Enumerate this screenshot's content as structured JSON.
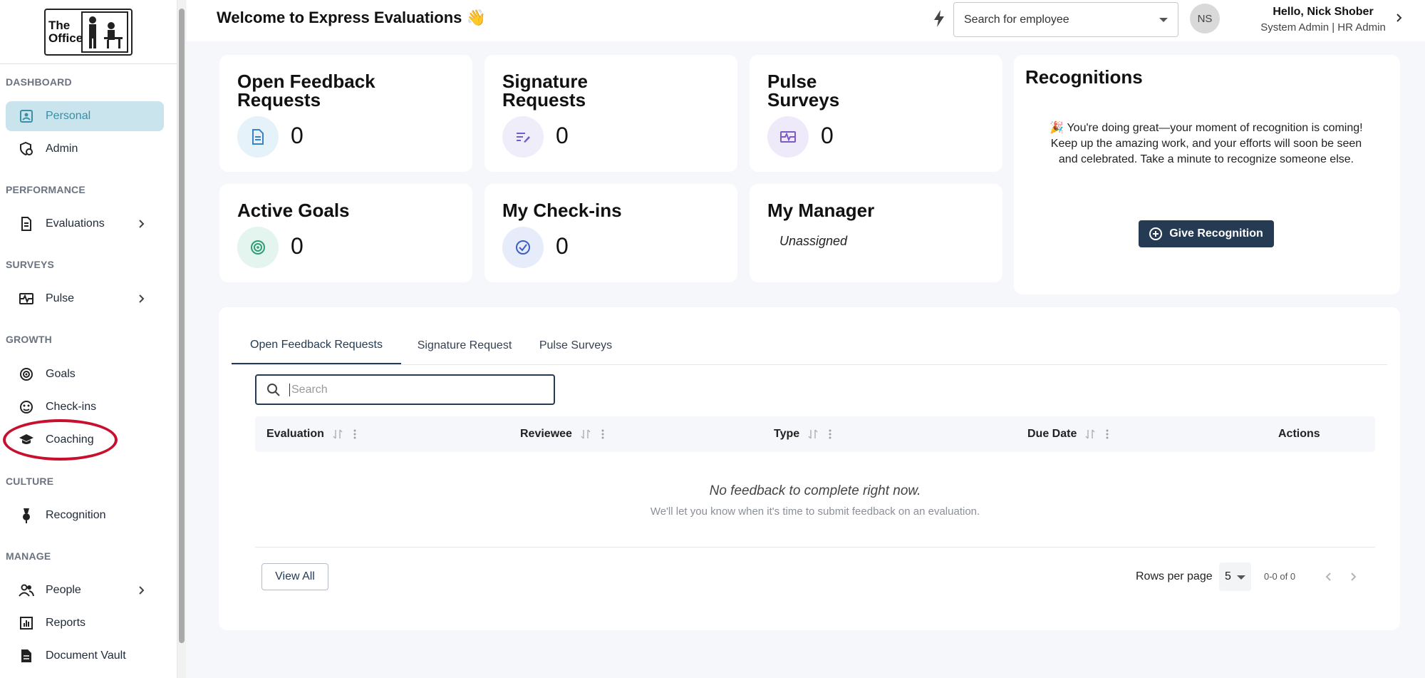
{
  "logo": {
    "line1": "The",
    "line2": "Office"
  },
  "sidebar": {
    "sections": [
      {
        "label": "DASHBOARD"
      },
      {
        "label": "PERFORMANCE"
      },
      {
        "label": "SURVEYS"
      },
      {
        "label": "GROWTH"
      },
      {
        "label": "CULTURE"
      },
      {
        "label": "MANAGE"
      }
    ],
    "items": [
      {
        "label": "Personal",
        "icon": "profile-card-icon",
        "active": true
      },
      {
        "label": "Admin",
        "icon": "admin-settings-icon"
      },
      {
        "label": "Evaluations",
        "icon": "document-icon",
        "expandable": true
      },
      {
        "label": "Pulse",
        "icon": "pulse-icon",
        "expandable": true
      },
      {
        "label": "Goals",
        "icon": "target-icon"
      },
      {
        "label": "Check-ins",
        "icon": "chat-face-icon"
      },
      {
        "label": "Coaching",
        "icon": "graduation-cap-icon"
      },
      {
        "label": "Recognition",
        "icon": "medal-icon"
      },
      {
        "label": "People",
        "icon": "people-icon",
        "expandable": true
      },
      {
        "label": "Reports",
        "icon": "bar-chart-icon"
      },
      {
        "label": "Document Vault",
        "icon": "file-icon"
      }
    ]
  },
  "header": {
    "title": "Welcome to Express Evaluations 👋",
    "search_value": "Search for employee",
    "avatar_initials": "NS",
    "user_name": "Hello, Nick Shober",
    "user_role": "System Admin |  HR Admin"
  },
  "cards": {
    "open_feedback": {
      "title": "Open Feedback Requests",
      "value": "0"
    },
    "signature": {
      "title": "Signature Requests",
      "value": "0"
    },
    "pulse": {
      "title": "Pulse Surveys",
      "value": "0"
    },
    "goals": {
      "title": "Active Goals",
      "value": "0"
    },
    "checkins": {
      "title": "My Check-ins",
      "value": "0"
    },
    "manager": {
      "title": "My Manager",
      "value": "Unassigned"
    }
  },
  "recognitions": {
    "title": "Recognitions",
    "message": "🎉 You're doing great—your moment of recognition is coming! Keep up the amazing work, and your efforts will soon be seen and celebrated. Take a minute to recognize someone else.",
    "button": "Give Recognition"
  },
  "tabs": [
    "Open Feedback Requests",
    "Signature Request",
    "Pulse Surveys"
  ],
  "table": {
    "search_placeholder": "Search",
    "columns": [
      "Evaluation",
      "Reviewee",
      "Type",
      "Due Date",
      "Actions"
    ],
    "empty_title": "No feedback to complete right now.",
    "empty_subtitle": "We'll let you know when it's time to submit feedback on an evaluation.",
    "view_all": "View All",
    "rows_per_page_label": "Rows per page",
    "rows_per_page": "5",
    "range": "0-0 of 0"
  },
  "colors": {
    "accent": "#243b53",
    "active_nav_bg": "#c9e4ec",
    "annotation": "#c8102e"
  }
}
